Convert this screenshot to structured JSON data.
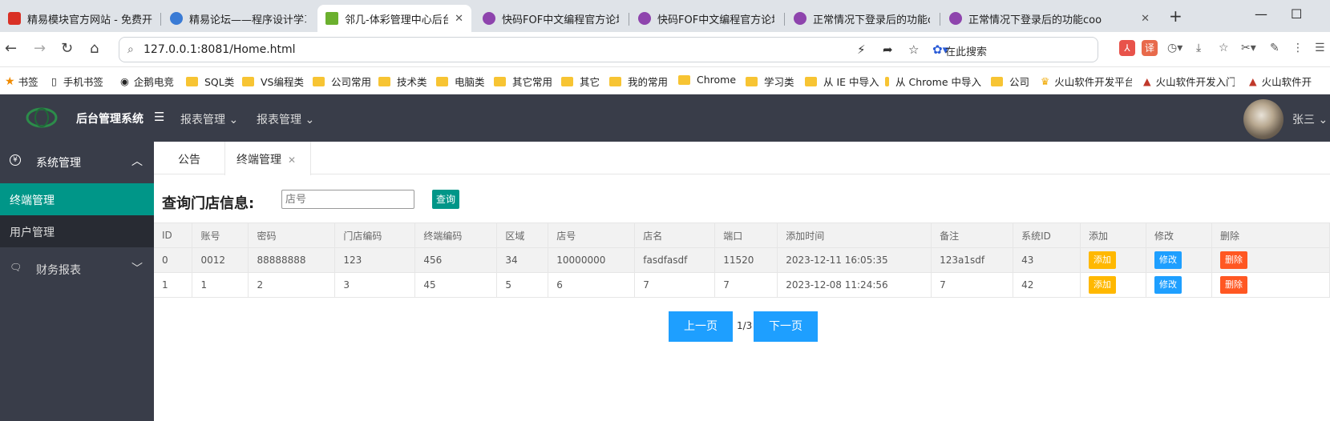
{
  "browser": {
    "tabs": [
      {
        "title": "精易模块官方网站 - 免费开源的",
        "favicon": "#d93025",
        "active": false
      },
      {
        "title": "精易论坛——程序设计学习交",
        "favicon": "#3a7bd5",
        "active": false
      },
      {
        "title": "邻几-体彩管理中心后台",
        "favicon": "#6bb02e",
        "active": true
      },
      {
        "title": "快码FOF中文编程官方论坛-P",
        "favicon": "#8e44ad",
        "active": false
      },
      {
        "title": "快码FOF中文编程官方论坛-P",
        "favicon": "#8e44ad",
        "active": false
      },
      {
        "title": "正常情况下登录后的功能coo",
        "favicon": "#8e44ad",
        "active": false
      },
      {
        "title": "正常情况下登录后的功能coo",
        "favicon": "#8e44ad",
        "active": false
      }
    ],
    "url": "127.0.0.1:8081/Home.html",
    "search_placeholder": "在此搜索",
    "bookmarks": [
      "书签",
      "手机书签",
      "企鹅电竞",
      "SQL类",
      "VS编程类",
      "公司常用",
      "技术类",
      "电脑类",
      "其它常用",
      "其它",
      "我的常用",
      "Chrome",
      "学习类",
      "从 IE 中导入",
      "从 Chrome 中导入",
      "公司",
      "火山软件开发平台",
      "火山软件开发入门",
      "火山软件开"
    ]
  },
  "app": {
    "brand": "后台管理系统",
    "top_menu": [
      "报表管理",
      "报表管理"
    ],
    "user": "张三",
    "sidebar": {
      "system_group": "系统管理",
      "items": [
        "终端管理",
        "用户管理"
      ],
      "finance_group": "财务报表"
    },
    "content_tabs": [
      "公告",
      "终端管理"
    ],
    "query": {
      "label": "查询门店信息:",
      "placeholder": "店号",
      "button": "查询"
    },
    "table": {
      "headers": [
        "ID",
        "账号",
        "密码",
        "门店编码",
        "终端编码",
        "区域",
        "店号",
        "店名",
        "端口",
        "添加时间",
        "备注",
        "系统ID",
        "添加",
        "修改",
        "删除"
      ],
      "rows": [
        [
          "0",
          "0012",
          "88888888",
          "123",
          "456",
          "34",
          "10000000",
          "fasdfasdf",
          "11520",
          "2023-12-11 16:05:35",
          "123a1sdf",
          "43"
        ],
        [
          "1",
          "1",
          "2",
          "3",
          "45",
          "5",
          "6",
          "7",
          "7",
          "2023-12-08 11:24:56",
          "7",
          "42"
        ]
      ],
      "action_labels": {
        "add": "添加",
        "edit": "修改",
        "delete": "删除"
      }
    },
    "pager": {
      "prev": "上一页",
      "info": "1/3",
      "next": "下一页"
    }
  },
  "colors": {
    "nav_bg": "#393d49",
    "active_green": "#009688",
    "add": "#ffb800",
    "edit": "#1e9fff",
    "delete": "#ff5722"
  }
}
